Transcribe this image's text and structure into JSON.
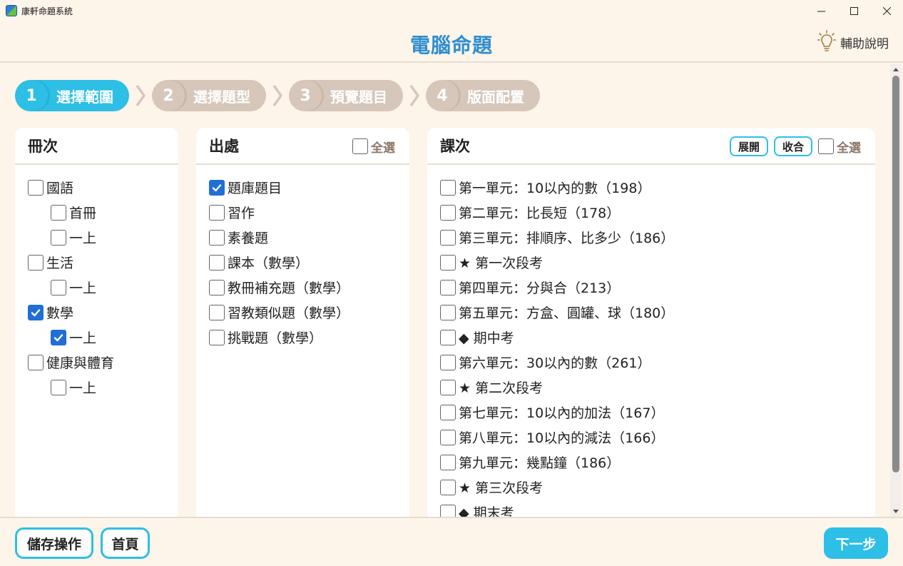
{
  "window": {
    "title": "康軒命題系統",
    "controls": [
      "–",
      "□",
      "✕"
    ]
  },
  "header": {
    "title": "電腦命題",
    "help_label": "輔助說明"
  },
  "steps": [
    {
      "num": "1",
      "label": "選擇範圍",
      "active": true
    },
    {
      "num": "2",
      "label": "選擇題型",
      "active": false
    },
    {
      "num": "3",
      "label": "預覽題目",
      "active": false
    },
    {
      "num": "4",
      "label": "版面配置",
      "active": false
    }
  ],
  "volumes": {
    "title": "冊次",
    "items": [
      {
        "label": "國語",
        "checked": false,
        "indent": false
      },
      {
        "label": "首冊",
        "checked": false,
        "indent": true
      },
      {
        "label": "一上",
        "checked": false,
        "indent": true
      },
      {
        "label": "生活",
        "checked": false,
        "indent": false
      },
      {
        "label": "一上",
        "checked": false,
        "indent": true
      },
      {
        "label": "數學",
        "checked": true,
        "indent": false
      },
      {
        "label": "一上",
        "checked": true,
        "indent": true
      },
      {
        "label": "健康與體育",
        "checked": false,
        "indent": false
      },
      {
        "label": "一上",
        "checked": false,
        "indent": true
      }
    ]
  },
  "sources": {
    "title": "出處",
    "select_all": "全選",
    "items": [
      {
        "label": "題庫題目",
        "checked": true
      },
      {
        "label": "習作",
        "checked": false
      },
      {
        "label": "素養題",
        "checked": false
      },
      {
        "label": "課本（數學）",
        "checked": false
      },
      {
        "label": "教冊補充題（數學）",
        "checked": false
      },
      {
        "label": "習教類似題（數學）",
        "checked": false
      },
      {
        "label": "挑戰題（數學）",
        "checked": false
      }
    ]
  },
  "lessons": {
    "title": "課次",
    "expand_label": "展開",
    "collapse_label": "收合",
    "select_all": "全選",
    "items": [
      {
        "label": "第一單元：10以內的數（198）",
        "checked": false
      },
      {
        "label": "第二單元：比長短（178）",
        "checked": false
      },
      {
        "label": "第三單元：排順序、比多少（186）",
        "checked": false
      },
      {
        "label": "★ 第一次段考",
        "checked": false
      },
      {
        "label": "第四單元：分與合（213）",
        "checked": false
      },
      {
        "label": "第五單元：方盒、圓罐、球（180）",
        "checked": false
      },
      {
        "label": "◆ 期中考",
        "checked": false
      },
      {
        "label": "第六單元：30以內的數（261）",
        "checked": false
      },
      {
        "label": "★ 第二次段考",
        "checked": false
      },
      {
        "label": "第七單元：10以內的加法（167）",
        "checked": false
      },
      {
        "label": "第八單元：10以內的減法（166）",
        "checked": false
      },
      {
        "label": "第九單元：幾點鐘（186）",
        "checked": false
      },
      {
        "label": "★ 第三次段考",
        "checked": false
      },
      {
        "label": "◆ 期末考",
        "checked": false
      }
    ]
  },
  "footer": {
    "save_label": "儲存操作",
    "home_label": "首頁",
    "next_label": "下一步"
  },
  "colors": {
    "accent": "#2dbfe6",
    "title": "#2f8ecf",
    "checkbox": "#1f6fd6",
    "inactive_step": "#d6c7ba",
    "background": "#fdf4ea"
  }
}
